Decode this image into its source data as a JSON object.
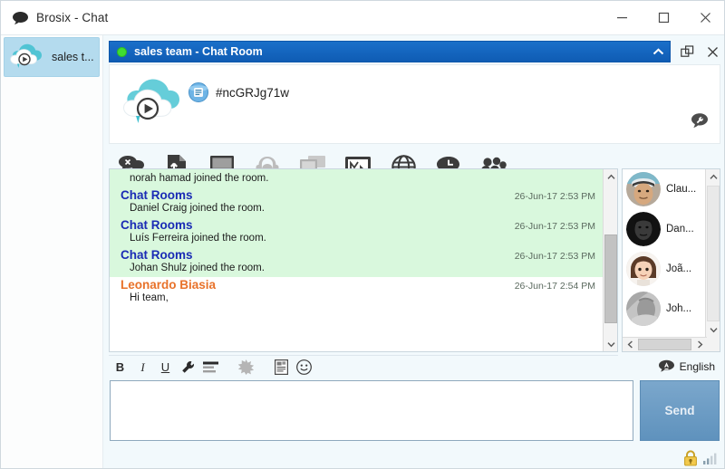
{
  "window": {
    "title": "Brosix - Chat",
    "icon": "chat-bubble-icon",
    "controls": {
      "minimize": "–",
      "maximize": "☐",
      "close": "✕"
    }
  },
  "sidebar": {
    "items": [
      {
        "label": "sales t...",
        "icon": "cloud-play-icon",
        "selected": true
      }
    ]
  },
  "room": {
    "status": "online",
    "status_color": "#3fdd32",
    "title": "sales team - Chat Room",
    "header_color": "#1565c0",
    "collapse_icon": "chevron-up-icon",
    "popout_icon": "pop-out-icon",
    "close_icon": "close-icon",
    "id": "#ncGRJg71w",
    "id_icon": "room-id-icon",
    "logo_icon": "brosix-cloud-logo",
    "settings_icon": "wrench-bubble-icon"
  },
  "toolbar": {
    "buttons": [
      {
        "name": "voice-chat-icon",
        "title": "Voice Chat"
      },
      {
        "name": "send-file-icon",
        "title": "Send File"
      },
      {
        "name": "screen-share-icon",
        "title": "Screen Sharing"
      },
      {
        "name": "conference-icon",
        "title": "Audio Conference"
      },
      {
        "name": "remote-desktop-icon",
        "title": "Remote Desktop"
      },
      {
        "name": "whiteboard-icon",
        "title": "Whiteboard"
      },
      {
        "name": "co-browse-icon",
        "title": "Co-Browse"
      },
      {
        "name": "chat-history-icon",
        "title": "Chat History"
      },
      {
        "name": "user-group-icon",
        "title": "Members"
      }
    ]
  },
  "chat": {
    "messages": [
      {
        "kind": "plain",
        "bg": "green",
        "text": "norah hamad joined the room."
      },
      {
        "kind": "entry",
        "bg": "green",
        "author": "Chat Rooms",
        "author_type": "system",
        "time": "26-Jun-17 2:53 PM",
        "text": "Daniel Craig joined the room."
      },
      {
        "kind": "entry",
        "bg": "green",
        "author": "Chat Rooms",
        "author_type": "system",
        "time": "26-Jun-17 2:53 PM",
        "text": "Luís Ferreira joined the room."
      },
      {
        "kind": "entry",
        "bg": "green",
        "author": "Chat Rooms",
        "author_type": "system",
        "time": "26-Jun-17 2:53 PM",
        "text": "Johan Shulz joined the room."
      },
      {
        "kind": "entry",
        "bg": "white",
        "author": "Leonardo Biasia",
        "author_type": "user",
        "time": "26-Jun-17 2:54 PM",
        "text": "Hi team,"
      }
    ],
    "system_author_color": "#1a2bb5",
    "user_author_color": "#e8722a",
    "highlight_bg": "#d9f8dd",
    "scroll_up_icon": "chevron-up-icon",
    "scroll_down_icon": "chevron-down-icon"
  },
  "participants": {
    "items": [
      {
        "name": "Clau...",
        "avatar": "photo-man-cap"
      },
      {
        "name": "Dan...",
        "avatar": "photo-man-dark"
      },
      {
        "name": "Joã...",
        "avatar": "cartoon-woman"
      },
      {
        "name": "Joh...",
        "avatar": "photo-grey-man"
      }
    ],
    "scroll_left_icon": "chevron-left-icon",
    "scroll_right_icon": "chevron-right-icon",
    "scroll_up_icon": "chevron-up-icon",
    "scroll_down_icon": "chevron-down-icon"
  },
  "format_toolbar": {
    "buttons": [
      {
        "name": "bold-button",
        "glyph": "B",
        "title": "Bold"
      },
      {
        "name": "italic-button",
        "glyph": "I",
        "title": "Italic"
      },
      {
        "name": "underline-button",
        "glyph": "U",
        "title": "Underline"
      },
      {
        "name": "font-settings-icon",
        "glyph": "wrench",
        "title": "Font Settings"
      },
      {
        "name": "align-icon",
        "glyph": "align",
        "title": "Alignment"
      },
      {
        "name": "nudge-icon",
        "glyph": "burst",
        "title": "Nudge"
      },
      {
        "name": "template-icon",
        "glyph": "doc",
        "title": "Templates"
      },
      {
        "name": "emoticon-icon",
        "glyph": "smiley",
        "title": "Emoticons"
      }
    ]
  },
  "composer": {
    "value": "",
    "placeholder": "",
    "send_label": "Send",
    "send_color": "#6d9cc4",
    "language": "English",
    "language_icon": "translate-bubble-icon"
  },
  "statusbar": {
    "lock_icon": "padlock-icon",
    "signal_icon": "signal-strength-icon"
  }
}
